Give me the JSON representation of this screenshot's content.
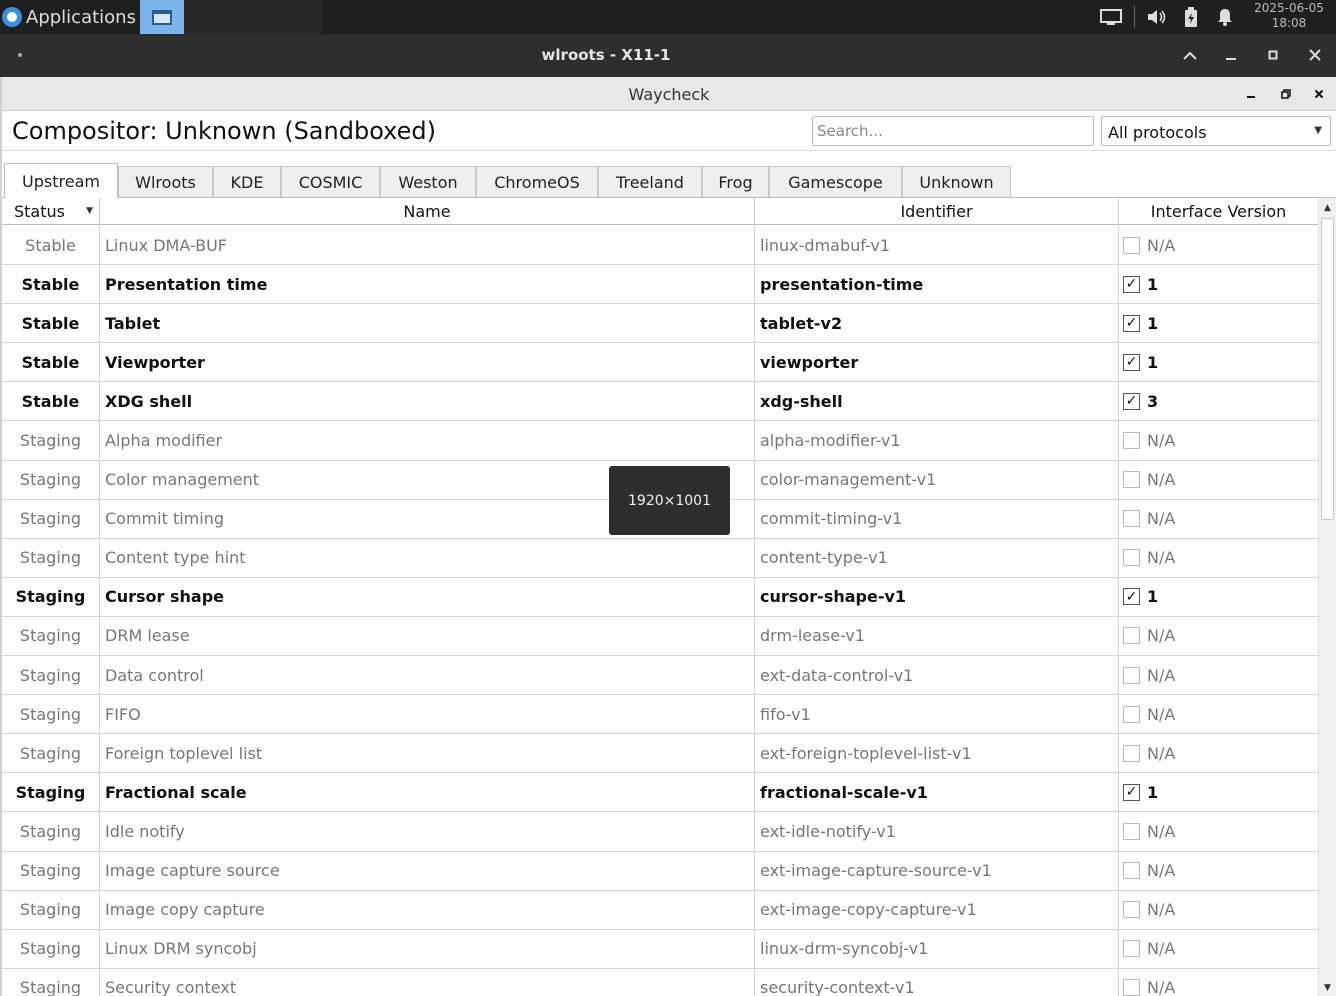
{
  "taskbar": {
    "apps_label": "Applications",
    "clock_date": "2025-06-05",
    "clock_time": "18:08"
  },
  "outer_window": {
    "title": "wlroots - X11-1",
    "dot": "•"
  },
  "app": {
    "window_title": "Waycheck",
    "compositor_title": "Compositor: Unknown (Sandboxed)",
    "search_placeholder": "Search...",
    "filter_selected": "All protocols"
  },
  "tabs": [
    "Upstream",
    "Wlroots",
    "KDE",
    "COSMIC",
    "Weston",
    "ChromeOS",
    "Treeland",
    "Frog",
    "Gamescope",
    "Unknown"
  ],
  "active_tab": "Upstream",
  "table": {
    "columns": [
      "Status",
      "Name",
      "Identifier",
      "Interface Version"
    ],
    "rows": [
      {
        "status": "Stable",
        "name": "Linux DMA-BUF",
        "identifier": "linux-dmabuf-v1",
        "supported": false,
        "version": "N/A"
      },
      {
        "status": "Stable",
        "name": "Presentation time",
        "identifier": "presentation-time",
        "supported": true,
        "version": "1"
      },
      {
        "status": "Stable",
        "name": "Tablet",
        "identifier": "tablet-v2",
        "supported": true,
        "version": "1"
      },
      {
        "status": "Stable",
        "name": "Viewporter",
        "identifier": "viewporter",
        "supported": true,
        "version": "1"
      },
      {
        "status": "Stable",
        "name": "XDG shell",
        "identifier": "xdg-shell",
        "supported": true,
        "version": "3"
      },
      {
        "status": "Staging",
        "name": "Alpha modifier",
        "identifier": "alpha-modifier-v1",
        "supported": false,
        "version": "N/A"
      },
      {
        "status": "Staging",
        "name": "Color management",
        "identifier": "color-management-v1",
        "supported": false,
        "version": "N/A"
      },
      {
        "status": "Staging",
        "name": "Commit timing",
        "identifier": "commit-timing-v1",
        "supported": false,
        "version": "N/A"
      },
      {
        "status": "Staging",
        "name": "Content type hint",
        "identifier": "content-type-v1",
        "supported": false,
        "version": "N/A"
      },
      {
        "status": "Staging",
        "name": "Cursor shape",
        "identifier": "cursor-shape-v1",
        "supported": true,
        "version": "1"
      },
      {
        "status": "Staging",
        "name": "DRM lease",
        "identifier": "drm-lease-v1",
        "supported": false,
        "version": "N/A"
      },
      {
        "status": "Staging",
        "name": "Data control",
        "identifier": "ext-data-control-v1",
        "supported": false,
        "version": "N/A"
      },
      {
        "status": "Staging",
        "name": "FIFO",
        "identifier": "fifo-v1",
        "supported": false,
        "version": "N/A"
      },
      {
        "status": "Staging",
        "name": "Foreign toplevel list",
        "identifier": "ext-foreign-toplevel-list-v1",
        "supported": false,
        "version": "N/A"
      },
      {
        "status": "Staging",
        "name": "Fractional scale",
        "identifier": "fractional-scale-v1",
        "supported": true,
        "version": "1"
      },
      {
        "status": "Staging",
        "name": "Idle notify",
        "identifier": "ext-idle-notify-v1",
        "supported": false,
        "version": "N/A"
      },
      {
        "status": "Staging",
        "name": "Image capture source",
        "identifier": "ext-image-capture-source-v1",
        "supported": false,
        "version": "N/A"
      },
      {
        "status": "Staging",
        "name": "Image copy capture",
        "identifier": "ext-image-copy-capture-v1",
        "supported": false,
        "version": "N/A"
      },
      {
        "status": "Staging",
        "name": "Linux DRM syncobj",
        "identifier": "linux-drm-syncobj-v1",
        "supported": false,
        "version": "N/A"
      },
      {
        "status": "Staging",
        "name": "Security context",
        "identifier": "security-context-v1",
        "supported": false,
        "version": "N/A"
      }
    ]
  },
  "resize_tooltip": "1920×1001",
  "icons": {
    "apps": "apps-logo-icon",
    "window": "window-icon",
    "display": "display-icon",
    "volume": "volume-icon",
    "battery": "battery-icon",
    "bell": "bell-icon"
  }
}
